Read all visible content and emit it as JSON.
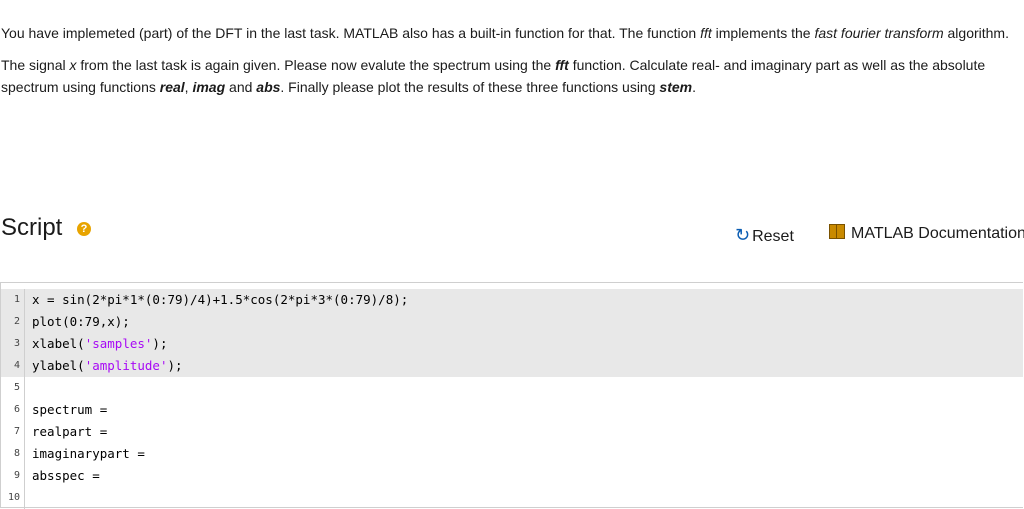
{
  "instructions": {
    "p1_a": "You have implemeted (part) of the DFT in the last task. MATLAB also has a built-in function for that. The function ",
    "p1_fft": "fft",
    "p1_b": " implements the ",
    "p1_fft_full": "fast fourier transform",
    "p1_c": " algorithm.",
    "p2_a": "The signal ",
    "p2_x": "x",
    "p2_b": " from the last task is again given. Please now evalute the spectrum using the ",
    "p2_fft": "fft",
    "p2_c": " function. Calculate real- and imaginary part as well as the absolute spectrum using functions ",
    "p2_real": "real",
    "p2_d": ", ",
    "p2_imag": "imag",
    "p2_e": " and ",
    "p2_abs": "abs",
    "p2_f": ". Finally please plot the results of these three functions using ",
    "p2_stem": "stem",
    "p2_g": "."
  },
  "script": {
    "title": "Script",
    "help_icon": "?",
    "reset_label": "Reset",
    "reset_icon": "↻",
    "doc_label": "MATLAB Documentation"
  },
  "editor": {
    "lines": [
      {
        "num": "1",
        "pre": "x = sin(2*pi*1*(0:79)/4)+1.5*cos(2*pi*3*(0:79)/8);",
        "str": "",
        "post": ""
      },
      {
        "num": "2",
        "pre": "plot(0:79,x);",
        "str": "",
        "post": ""
      },
      {
        "num": "3",
        "pre": "xlabel(",
        "str": "'samples'",
        "post": ");"
      },
      {
        "num": "4",
        "pre": "ylabel(",
        "str": "'amplitude'",
        "post": ");"
      },
      {
        "num": "5",
        "pre": "",
        "str": "",
        "post": ""
      },
      {
        "num": "6",
        "pre": "spectrum =",
        "str": "",
        "post": ""
      },
      {
        "num": "7",
        "pre": "realpart =",
        "str": "",
        "post": ""
      },
      {
        "num": "8",
        "pre": "imaginarypart =",
        "str": "",
        "post": ""
      },
      {
        "num": "9",
        "pre": "absspec =",
        "str": "",
        "post": ""
      },
      {
        "num": "10",
        "pre": "",
        "str": "",
        "post": ""
      }
    ]
  }
}
